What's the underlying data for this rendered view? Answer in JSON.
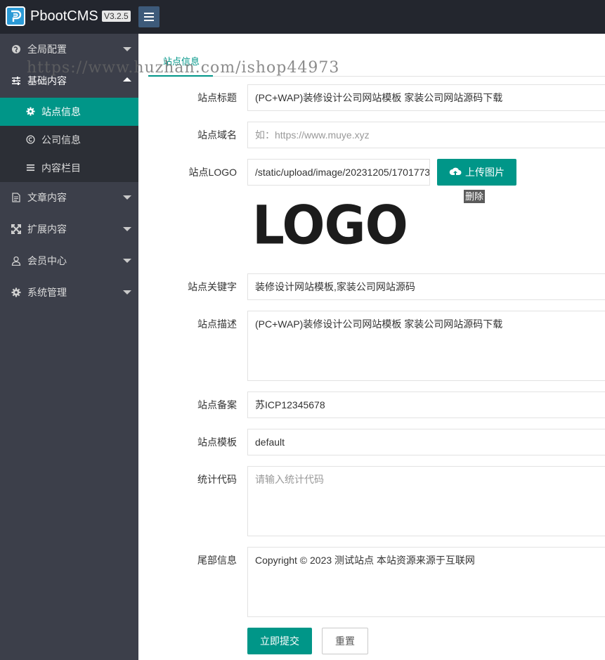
{
  "header": {
    "brand": "PbootCMS",
    "version": "V3.2.5",
    "menu_toggle_icon": "hamburger-icon"
  },
  "sidebar": {
    "items": [
      {
        "label": "全局配置",
        "icon": "globe-icon",
        "expanded": false
      },
      {
        "label": "基础内容",
        "icon": "sliders-icon",
        "expanded": true
      },
      {
        "label": "文章内容",
        "icon": "document-icon",
        "expanded": false
      },
      {
        "label": "扩展内容",
        "icon": "expand-icon",
        "expanded": false
      },
      {
        "label": "会员中心",
        "icon": "user-icon",
        "expanded": false
      },
      {
        "label": "系统管理",
        "icon": "gear-icon",
        "expanded": false
      }
    ],
    "subitems": [
      {
        "label": "站点信息",
        "icon": "gear-icon",
        "active": true
      },
      {
        "label": "公司信息",
        "icon": "copyright-icon",
        "active": false
      },
      {
        "label": "内容栏目",
        "icon": "list-icon",
        "active": false
      }
    ]
  },
  "main": {
    "tab": "站点信息",
    "watermark": "https://www.huzhan.com/ishop44973",
    "form": {
      "title": {
        "label": "站点标题",
        "value": "(PC+WAP)装修设计公司网站模板 家装公司网站源码下载"
      },
      "domain": {
        "label": "站点域名",
        "value": "",
        "placeholder": "如：https://www.muye.xyz"
      },
      "logo": {
        "label": "站点LOGO",
        "value": "/static/upload/image/20231205/1701773",
        "upload_label": "上传图片",
        "delete_label": "删除",
        "preview_text": "LOGO"
      },
      "keywords": {
        "label": "站点关键字",
        "value": "装修设计网站模板,家装公司网站源码"
      },
      "description": {
        "label": "站点描述",
        "value": "(PC+WAP)装修设计公司网站模板 家装公司网站源码下载"
      },
      "icp": {
        "label": "站点备案",
        "value": "苏ICP12345678"
      },
      "template": {
        "label": "站点模板",
        "value": "default"
      },
      "statistics": {
        "label": "统计代码",
        "value": "",
        "placeholder": "请输入统计代码"
      },
      "footer": {
        "label": "尾部信息",
        "value": "Copyright © 2023 测试站点 本站资源来源于互联网"
      }
    },
    "submit_label": "立即提交",
    "reset_label": "重置"
  },
  "colors": {
    "accent": "#009688",
    "topbar": "#23262e",
    "sidebar": "#3c3f4a",
    "subnav": "#2c2f36"
  }
}
